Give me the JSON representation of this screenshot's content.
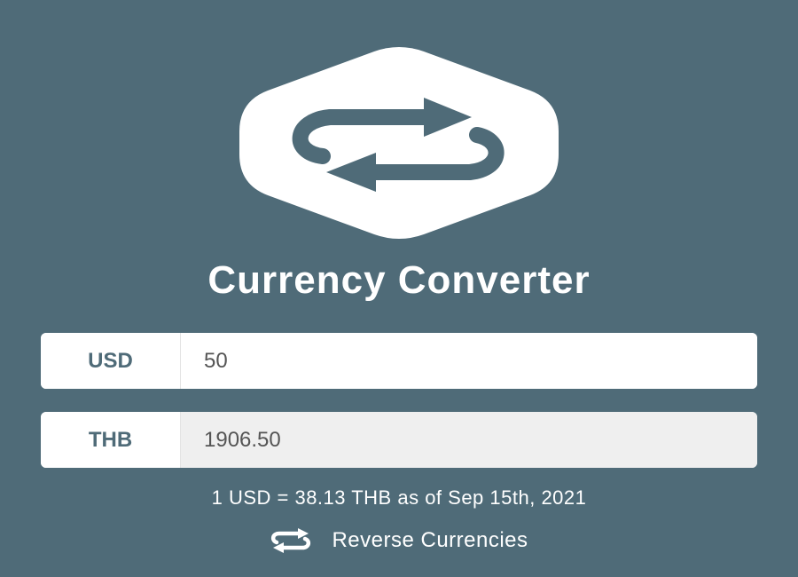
{
  "app": {
    "title": "Currency Converter",
    "logo_icon": "swap-arrows-icon"
  },
  "converter": {
    "from": {
      "currency": "USD",
      "amount": "50"
    },
    "to": {
      "currency": "THB",
      "amount": "1906.50"
    },
    "rate_text": "1 USD = 38.13 THB as of Sep 15th, 2021"
  },
  "actions": {
    "reverse_label": "Reverse Currencies",
    "reverse_icon": "swap-arrows-icon"
  },
  "colors": {
    "background": "#4f6b78",
    "card": "#ffffff",
    "readonly_field": "#efefef",
    "text_accent": "#4f6b78"
  }
}
